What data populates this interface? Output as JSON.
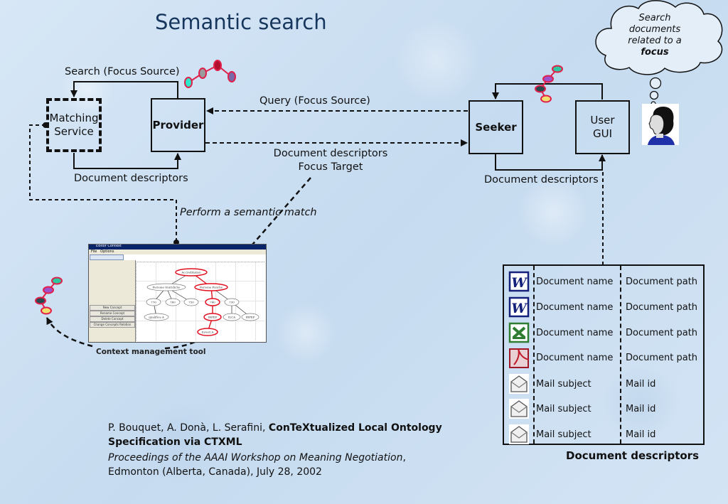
{
  "title": "Semantic search",
  "nodes": {
    "matching_service": "Matching Service",
    "provider": "Provider",
    "seeker": "Seeker",
    "user_gui": "User GUI"
  },
  "edges": {
    "search_focus_source": "Search (Focus Source)",
    "query_focus_source": "Query (Focus Source)",
    "doc_descriptors_left": "Document descriptors",
    "doc_descriptors_focus_line1": "Document descriptors",
    "doc_descriptors_focus_line2": "Focus Target",
    "doc_descriptors_right": "Document descriptors",
    "perform_semantic_match": "Perform a semantic match"
  },
  "thought_bubble": {
    "line1": "Search",
    "line2": "documents",
    "line3": "related to a",
    "line4": "focus"
  },
  "focus_chains": [
    {
      "name": "focus-chain-provider",
      "colors": [
        "#2ee6c8",
        "#9a9a9a",
        "#b0102e",
        "#7b6aa8"
      ]
    },
    {
      "name": "focus-chain-seeker",
      "colors": [
        "#2ec8a0",
        "#a050c8",
        "#2a4a50",
        "#f0e070"
      ]
    },
    {
      "name": "focus-chain-tool",
      "colors": [
        "#2ec8a0",
        "#a050c8",
        "#2a4a50",
        "#f0e070"
      ]
    }
  ],
  "tool_screenshot": {
    "caption": "Context management tool",
    "menu": [
      "File",
      "Options"
    ],
    "buttons": [
      "New Concept",
      "Rename Concept",
      "Delete Concept",
      "Change Concepts Relation"
    ],
    "tree_nodes": [
      "Accreditation",
      "Persone Giuridiche",
      "Persone Fisiche",
      "770",
      "760",
      "750",
      "740",
      "730",
      "qualifica A",
      "IRPEF",
      "ILCA",
      "IRPEF",
      "Invest A"
    ]
  },
  "document_table": {
    "caption": "Document descriptors",
    "rows": [
      {
        "icon": "word-icon",
        "name": "Document name",
        "path": "Document path"
      },
      {
        "icon": "word-icon",
        "name": "Document name",
        "path": "Document path"
      },
      {
        "icon": "excel-icon",
        "name": "Document name",
        "path": "Document path"
      },
      {
        "icon": "pdf-icon",
        "name": "Document name",
        "path": "Document path"
      },
      {
        "icon": "mail-icon",
        "name": "Mail subject",
        "path": "Mail id"
      },
      {
        "icon": "mail-icon",
        "name": "Mail subject",
        "path": "Mail id"
      },
      {
        "icon": "mail-icon",
        "name": "Mail subject",
        "path": "Mail id"
      }
    ]
  },
  "reference": {
    "authors": "P. Bouquet, A. Donà, L. Serafini, ",
    "paper_title_line1": "ConTeXtualized Local Ontology",
    "paper_title_line2": "Specification via CTXML",
    "venue": "Proceedings of the AAAI Workshop on Meaning Negotiation",
    "venue_suffix": ",",
    "location": "Edmonton (Alberta, Canada), July 28, 2002"
  }
}
